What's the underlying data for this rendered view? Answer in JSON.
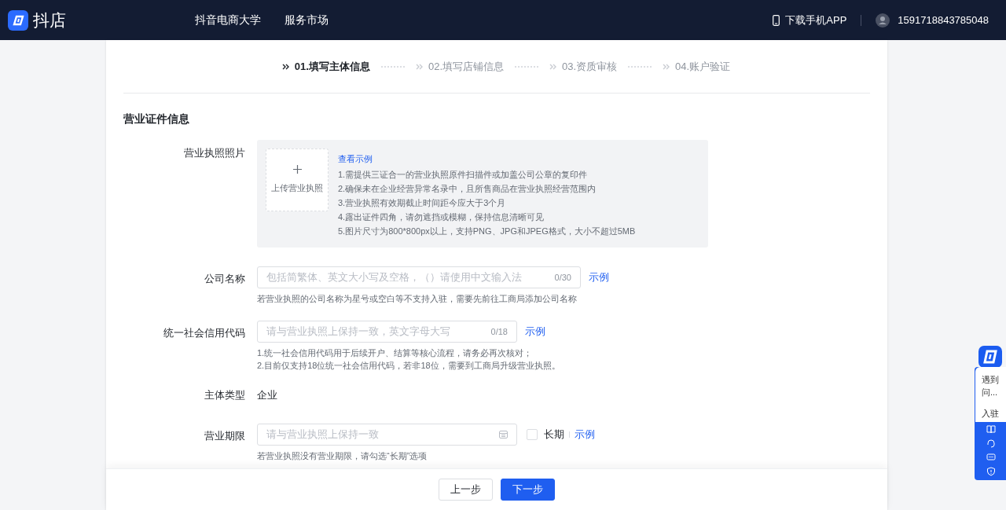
{
  "header": {
    "logo": "抖店",
    "nav": [
      "抖音电商大学",
      "服务市场"
    ],
    "download": "下载手机APP",
    "account": "1591718843785048"
  },
  "steps": [
    {
      "label": "01.填写主体信息",
      "selected": true
    },
    {
      "label": "02.填写店铺信息",
      "selected": false
    },
    {
      "label": "03.资质审核",
      "selected": false
    },
    {
      "label": "04.账户验证",
      "selected": false
    }
  ],
  "section_title": "营业证件信息",
  "fields": [
    {
      "kind": "upload",
      "label": "营业执照照片",
      "upload_label": "上传营业执照",
      "example_link": "查看示例",
      "notes": [
        "1.需提供三证合一的营业执照原件扫描件或加盖公司公章的复印件",
        "2.确保未在企业经营异常名录中，且所售商品在营业执照经营范围内",
        "3.营业执照有效期截止时间距今应大于3个月",
        "4.露出证件四角，请勿遮挡或模糊，保持信息清晰可见",
        "5.图片尺寸为800*800px以上，支持PNG、JPG和JPEG格式，大小不超过5MB"
      ]
    },
    {
      "kind": "text",
      "label": "公司名称",
      "placeholder": "包括简繁体、英文大小写及空格，（）请使用中文输入法",
      "counter": "0/30",
      "example_link": "示例",
      "hints": [
        "若营业执照的公司名称为星号或空白等不支持入驻，需要先前往工商局添加公司名称"
      ]
    },
    {
      "kind": "text",
      "label": "统一社会信用代码",
      "placeholder": "请与营业执照上保持一致，英文字母大写",
      "counter": "0/18",
      "example_link": "示例",
      "hints": [
        "1.统一社会信用代码用于后续开户、结算等核心流程，请务必再次核对；",
        "2.目前仅支持18位统一社会信用代码，若非18位，需要到工商局升级营业执照。"
      ]
    },
    {
      "kind": "value",
      "label": "主体类型",
      "value": "企业"
    },
    {
      "kind": "date",
      "label": "营业期限",
      "placeholder": "请与营业执照上保持一致",
      "checkbox": {
        "label": "长期",
        "checked": false
      },
      "example_link": "示例",
      "hints": [
        "若营业执照没有营业期限，请勾选“长期”选项"
      ]
    }
  ],
  "buttons": [
    {
      "label": "上一步",
      "kind": "secondary"
    },
    {
      "label": "下一步",
      "kind": "primary"
    }
  ],
  "side_widget": {
    "message": "遇到问...",
    "action": "入驻"
  }
}
